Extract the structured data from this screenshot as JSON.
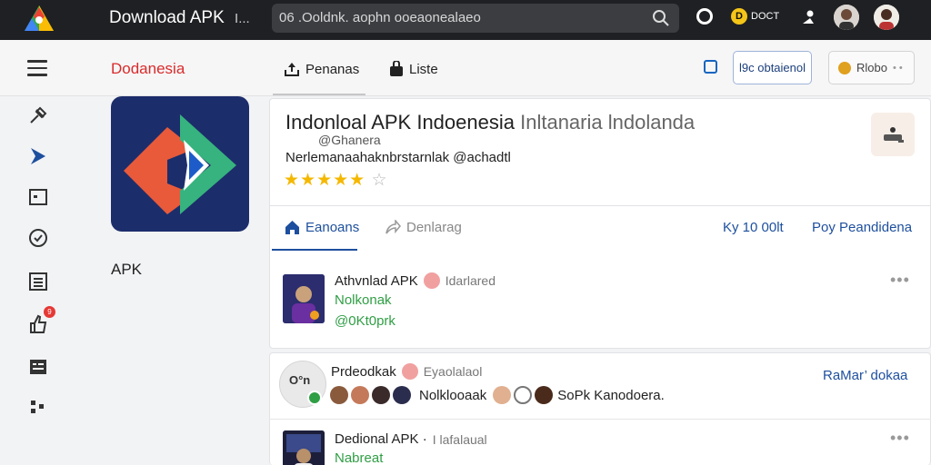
{
  "topbar": {
    "title": "Download APK",
    "title_extra": "I...",
    "search_text": "06 .Ooldnk. aophn ooeaonealaeo",
    "doct_label": "DOCT",
    "doct_badge": "D",
    "icons": [
      "app-logo-icon",
      "search-icon",
      "ring-icon",
      "doct-icon",
      "account-icon",
      "avatar-1",
      "avatar-2"
    ]
  },
  "header": {
    "brand": "Dodanesia",
    "nav": [
      {
        "label": "Penanas",
        "icon": "upload-icon"
      },
      {
        "label": "Liste",
        "icon": "bag-icon"
      }
    ],
    "action_primary": "l9c obtaienol",
    "action_secondary": "Rlobo",
    "action_secondary_caret": "• •"
  },
  "rail": {
    "icons": [
      "pin-icon",
      "send-icon",
      "folder-icon",
      "shield-icon",
      "grid-icon",
      "thumbs-up-icon",
      "list-icon",
      "apps-icon"
    ],
    "notification_count": "9"
  },
  "app": {
    "label": "APK",
    "title": "Indonloal APK Indoenesia",
    "title_light": "Inltanaria lndolanda",
    "handle": "@Ghanera",
    "subtitle": "Nerlemanaahaknbrstarnlak @achadtl",
    "rating_filled": "★★★★★",
    "rating_empty": "☆",
    "rating": 5
  },
  "tabs": [
    {
      "label": "Eanoans",
      "icon": "home-icon",
      "active": true
    },
    {
      "label": "Denlarag",
      "icon": "share-icon",
      "active": false
    }
  ],
  "right_links": {
    "count": "Ky 10 00lt",
    "peer": "Poy Peandidena"
  },
  "feed": [
    {
      "title": "Athvnlad APK",
      "badge": "Idarlared",
      "line1": "Nolkonak",
      "line2": "@0Kt0prk",
      "more": "•••"
    },
    {
      "avatar_text": "O°n",
      "title": "Prdeodkak",
      "badge": "Eyaolalaol",
      "link": "RaMar’ dokaa",
      "people_text": "Nolklooaak",
      "people_text2": "SoPk Kanodoera."
    },
    {
      "title": "Dedional APK ·",
      "badge": "I lafalaual",
      "line1": "Nabreat",
      "more": "•••"
    }
  ]
}
